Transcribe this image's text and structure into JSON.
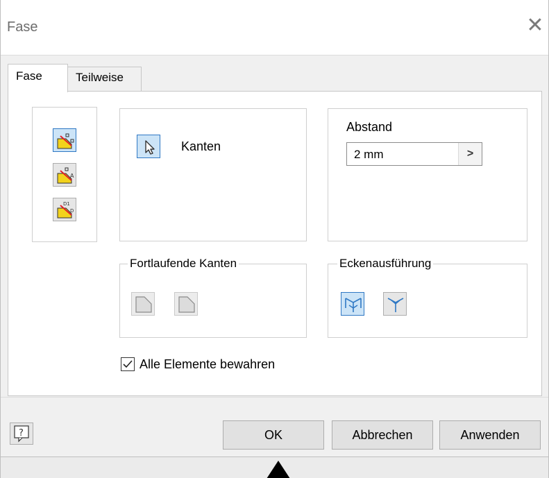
{
  "window": {
    "title": "Fase",
    "close_icon": "close-icon"
  },
  "tabs": [
    {
      "label": "Fase",
      "active": true
    },
    {
      "label": "Teilweise",
      "active": false
    }
  ],
  "modes": [
    {
      "icon": "chamfer-distance-icon",
      "pressed": true
    },
    {
      "icon": "chamfer-distance-angle-icon",
      "pressed": false
    },
    {
      "icon": "chamfer-two-distances-icon",
      "pressed": false
    }
  ],
  "edges": {
    "label": "Kanten",
    "icon": "cursor-select-icon"
  },
  "distance": {
    "label": "Abstand",
    "value": "2 mm",
    "arrow": ">"
  },
  "continuous_edges": {
    "legend": "Fortlaufende Kanten"
  },
  "corner_setback": {
    "legend": "Eckenausführung"
  },
  "preserve_all": {
    "label": "Alle Elemente bewahren",
    "checked": true
  },
  "buttons": {
    "ok": "OK",
    "cancel": "Abbrechen",
    "apply": "Anwenden"
  },
  "help_icon": "help-icon",
  "colors": {
    "accent": "#2f78c4",
    "pressed_bg": "#cce4f7",
    "chamfer_yellow": "#f2d21c",
    "edge_red": "#e0202a"
  }
}
